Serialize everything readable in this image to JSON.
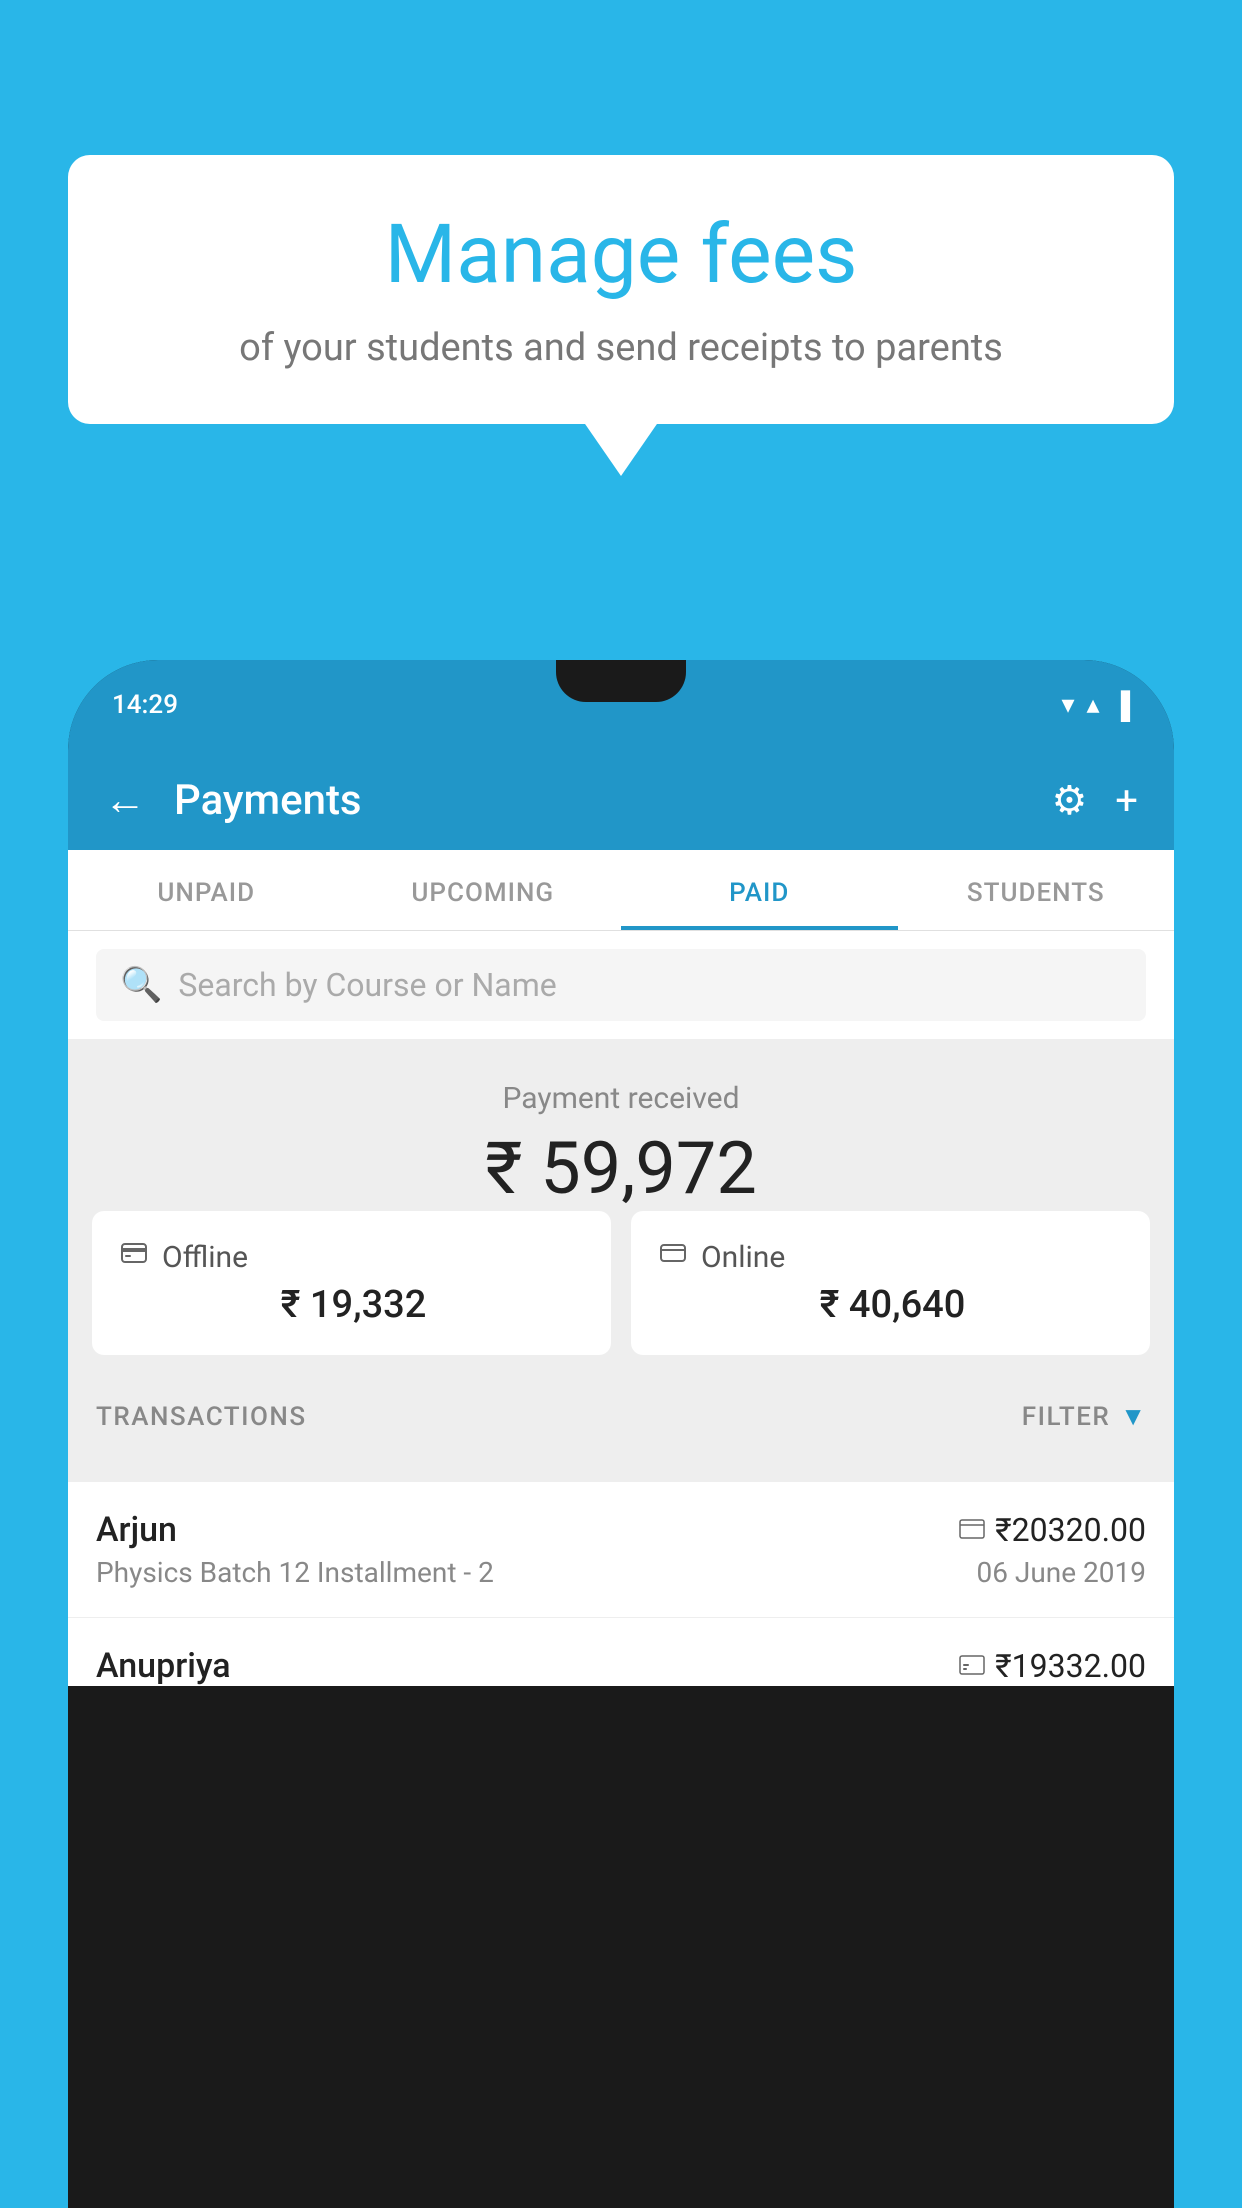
{
  "background_color": "#29b6e8",
  "bubble": {
    "title": "Manage fees",
    "subtitle": "of your students and send receipts to parents"
  },
  "status_bar": {
    "time": "14:29",
    "icons": [
      "▼",
      "▲",
      "▐"
    ]
  },
  "app_bar": {
    "title": "Payments",
    "back_label": "←",
    "settings_label": "⚙",
    "add_label": "+"
  },
  "tabs": [
    {
      "label": "UNPAID",
      "active": false
    },
    {
      "label": "UPCOMING",
      "active": false
    },
    {
      "label": "PAID",
      "active": true
    },
    {
      "label": "STUDENTS",
      "active": false
    }
  ],
  "search": {
    "placeholder": "Search by Course or Name"
  },
  "payment_received": {
    "label": "Payment received",
    "amount": "₹ 59,972"
  },
  "offline_card": {
    "icon": "💳",
    "type": "Offline",
    "amount": "₹ 19,332"
  },
  "online_card": {
    "icon": "💳",
    "type": "Online",
    "amount": "₹ 40,640"
  },
  "transactions_section": {
    "label": "TRANSACTIONS",
    "filter_label": "FILTER"
  },
  "transactions": [
    {
      "name": "Arjun",
      "amount_icon": "💳",
      "amount": "₹20320.00",
      "course": "Physics Batch 12 Installment - 2",
      "date": "06 June 2019"
    },
    {
      "name": "Anupriya",
      "amount_icon": "💴",
      "amount": "₹19332.00",
      "course": "",
      "date": ""
    }
  ]
}
